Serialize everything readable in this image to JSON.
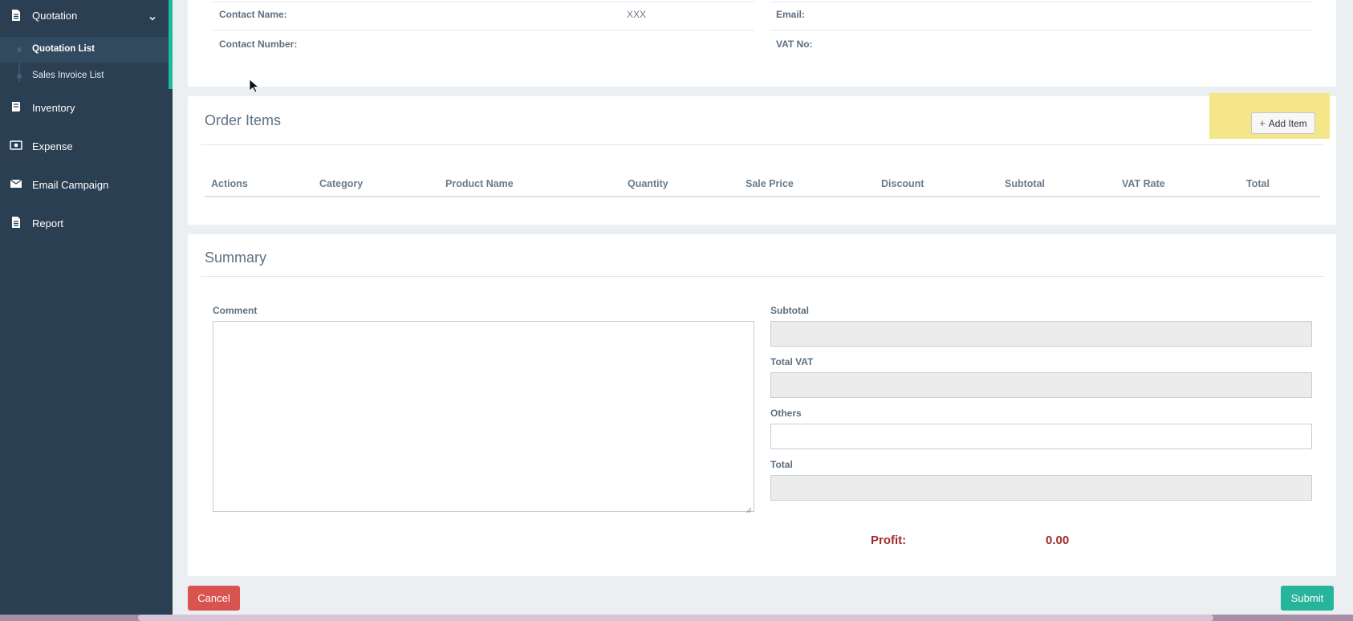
{
  "sidebar": {
    "items": [
      {
        "label": "Quotation",
        "icon": "document-icon"
      },
      {
        "label": "Inventory",
        "icon": "book-icon"
      },
      {
        "label": "Expense",
        "icon": "money-icon"
      },
      {
        "label": "Email Campaign",
        "icon": "envelope-icon"
      },
      {
        "label": "Report",
        "icon": "report-icon"
      }
    ],
    "sub_items": [
      {
        "label": "Quotation List",
        "active": true
      },
      {
        "label": "Sales Invoice List",
        "active": false
      }
    ]
  },
  "contact": {
    "contact_name_label": "Contact Name:",
    "contact_name_value": "XXX",
    "email_label": "Email:",
    "contact_number_label": "Contact Number:",
    "vat_no_label": "VAT No:"
  },
  "order_items": {
    "title": "Order Items",
    "add_item_label": "Add Item",
    "columns": [
      "Actions",
      "Category",
      "Product Name",
      "Quantity",
      "Sale Price",
      "Discount",
      "Subtotal",
      "VAT Rate",
      "Total"
    ]
  },
  "summary": {
    "title": "Summary",
    "comment_label": "Comment",
    "subtotal_label": "Subtotal",
    "total_vat_label": "Total VAT",
    "others_label": "Others",
    "total_label": "Total",
    "profit_label": "Profit:",
    "profit_value": "0.00"
  },
  "actions": {
    "cancel_label": "Cancel",
    "submit_label": "Submit"
  },
  "colors": {
    "sidebar_bg": "#2b3f53",
    "accent": "#1abc9c",
    "cancel": "#d9534f",
    "submit": "#26b59a",
    "profit": "#a52a2a",
    "highlight": "#f6e68a"
  }
}
